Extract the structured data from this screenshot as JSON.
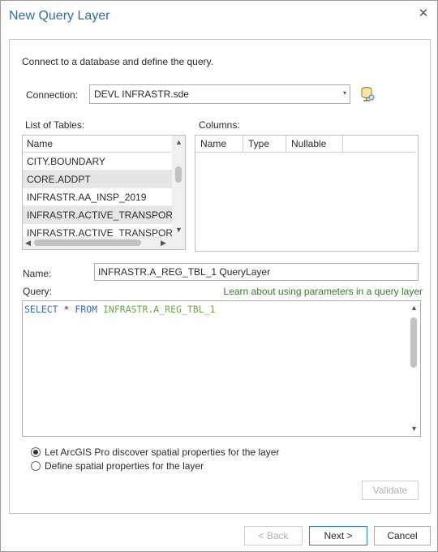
{
  "window": {
    "title": "New Query Layer",
    "close_glyph": "✕"
  },
  "intro_text": "Connect to a database and define the query.",
  "connection": {
    "label": "Connection:",
    "value": "DEVL INFRASTR.sde",
    "arrow": "▾",
    "icon": "database-connection-icon"
  },
  "tables": {
    "label": "List of Tables:",
    "column_header": "Name",
    "items": [
      "CITY.BOUNDARY",
      "CORE.ADDPT",
      "INFRASTR.AA_INSP_2019",
      "INFRASTR.ACTIVE_TRANSPORTATI",
      "INFRASTR.ACTIVE_TRANSPORTATI"
    ],
    "selected_index": 3
  },
  "columns": {
    "label": "Columns:",
    "headers": [
      "Name",
      "Type",
      "Nullable"
    ]
  },
  "name_field": {
    "label": "Name:",
    "value": "INFRASTR.A_REG_TBL_1 QueryLayer"
  },
  "query": {
    "label": "Query:",
    "help_link": "Learn about using parameters in a query layer",
    "kw_select": "SELECT",
    "star": "*",
    "kw_from": "FROM",
    "table": "INFRASTR.A_REG_TBL_1"
  },
  "spatial_options": [
    {
      "label": "Let ArcGIS Pro discover spatial properties for the layer",
      "checked": true
    },
    {
      "label": "Define spatial properties for the layer",
      "checked": false
    }
  ],
  "buttons": {
    "validate": "Validate",
    "back": "< Back",
    "next": "Next >",
    "cancel": "Cancel"
  },
  "scroll_arrows": {
    "up": "▲",
    "down": "▼",
    "left": "◀",
    "right": "▶"
  }
}
